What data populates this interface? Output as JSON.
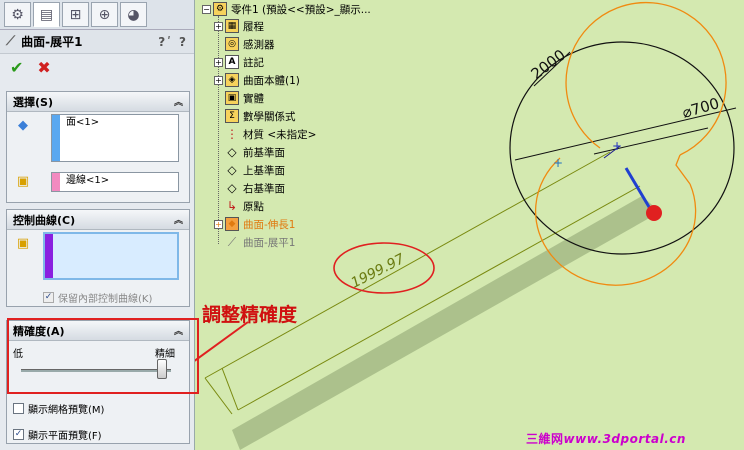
{
  "tabs": [
    {
      "name": "feature-manager-tab",
      "symbol": "⚙"
    },
    {
      "name": "property-manager-tab",
      "symbol": "▤"
    },
    {
      "name": "configuration-tab",
      "symbol": "⊞"
    },
    {
      "name": "dimxpert-tab",
      "symbol": "⊕"
    },
    {
      "name": "display-tab",
      "symbol": "◕"
    }
  ],
  "pm": {
    "title": "曲面-展平1",
    "help_icons": "?ʹ ?",
    "ok_symbol": "✔",
    "cancel_symbol": "✖"
  },
  "selection": {
    "header": "選擇(S)",
    "face_value": "面<1>",
    "edge_value": "邊線<1>"
  },
  "control_curve": {
    "header": "控制曲線(C)",
    "keep_label": "保留內部控制曲線(K)"
  },
  "accuracy": {
    "header": "精確度(A)",
    "low_label": "低",
    "high_label": "精細",
    "level": 1.0
  },
  "options": {
    "show_mesh_label": "顯示網格預覽(M)",
    "show_flat_label": "顯示平面預覽(F)",
    "show_mesh_checked": false,
    "show_flat_checked": true
  },
  "tree": {
    "root": "零件1 (預設<<預設>_顯示...",
    "items": [
      "履程",
      "感測器",
      "註記",
      "曲面本體(1)",
      "實體",
      "數學關係式",
      "材質 <未指定>",
      "前基準面",
      "上基準面",
      "右基準面",
      "原點",
      "曲面-伸長1",
      "曲面-展平1"
    ]
  },
  "viewport": {
    "dim_diameter_large": "2000",
    "dim_diameter_small": "⌀700",
    "dim_length": "1999.97"
  },
  "annotation": "調整精確度",
  "watermark": {
    "cn": "三維网",
    "url": "www.3dportal.cn"
  },
  "colors": {
    "viewport_bg": "#d4e9b0",
    "accent_red": "#e02020",
    "orange_curve": "#f08a10"
  }
}
